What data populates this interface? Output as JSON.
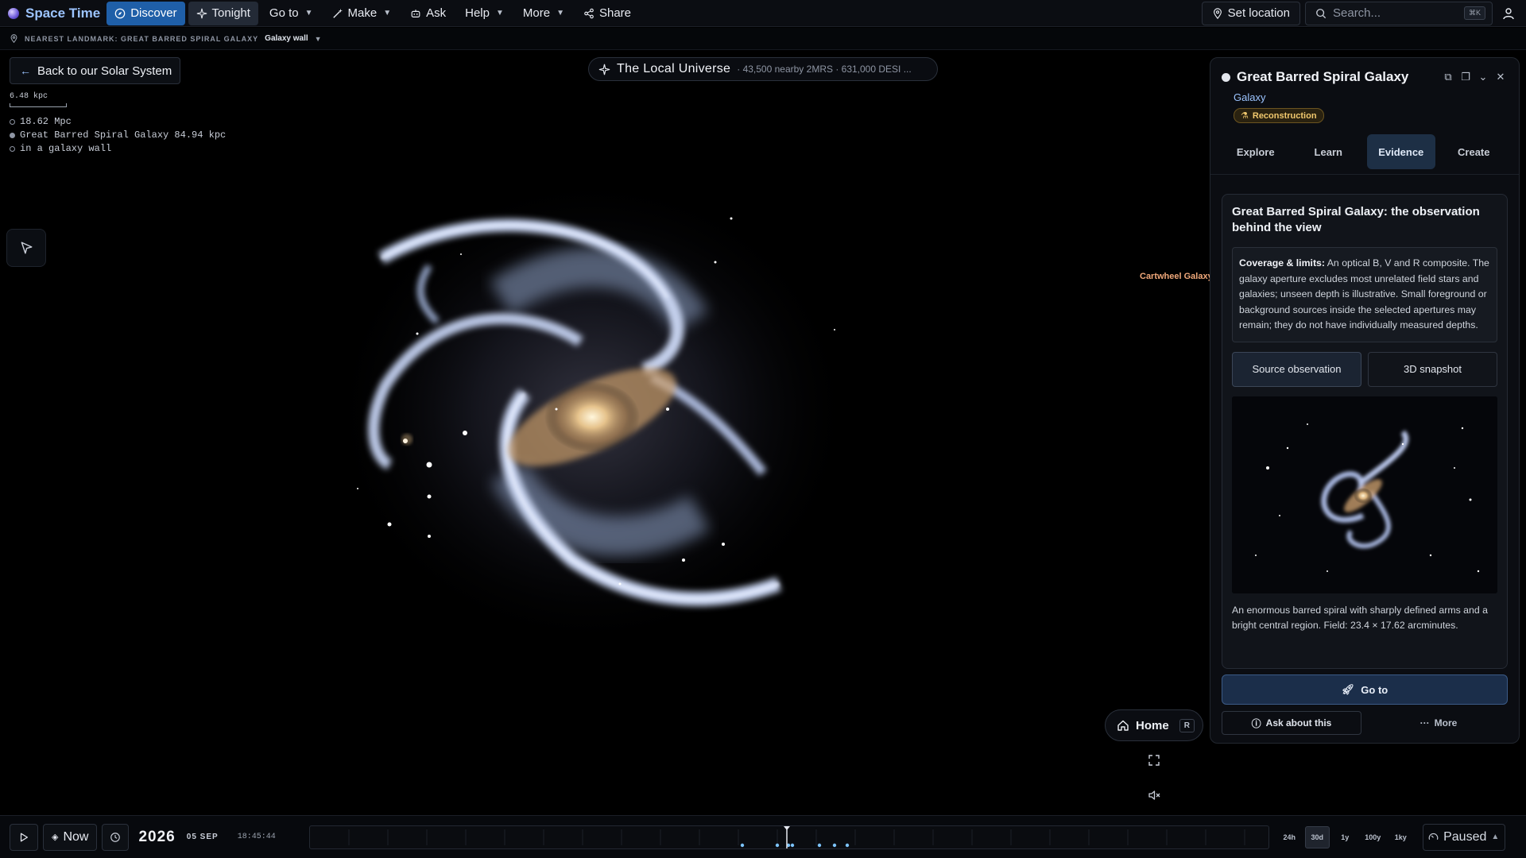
{
  "app": {
    "title": "Space Time",
    "nav": {
      "discover": "Discover",
      "tonight": "Tonight",
      "goto": "Go to",
      "make": "Make",
      "ask": "Ask",
      "help": "Help",
      "more": "More",
      "share": "Share"
    },
    "set_location": "Set location",
    "search_placeholder": "Search...",
    "search_shortcut": "⌘K"
  },
  "landmark": {
    "label": "NEAREST LANDMARK: GREAT BARRED SPIRAL GALAXY",
    "value": "Galaxy wall"
  },
  "viewer": {
    "back_label": "Back to our Solar System",
    "scale_label": "6.48 kpc",
    "context": [
      "18.62 Mpc",
      "Great Barred Spiral Galaxy 84.94 kpc",
      "in a galaxy wall"
    ],
    "universe_title": "The Local Universe",
    "universe_sub": "· 43,500 nearby 2MRS · 631,000 DESI ...",
    "neighbor_label": "Cartwheel Galaxy",
    "home_label": "Home",
    "home_key": "R"
  },
  "panel": {
    "title": "Great Barred Spiral Galaxy",
    "type": "Galaxy",
    "badge": "Reconstruction",
    "tabs": [
      "Explore",
      "Learn",
      "Evidence",
      "Create"
    ],
    "active_tab": "Evidence",
    "evidence_title": "Great Barred Spiral Galaxy: the observation behind the view",
    "coverage_label": "Coverage & limits:",
    "coverage_text": "An optical B, V and R composite. The galaxy aperture excludes most unrelated field stars and galaxies; unseen depth is illustrative. Small foreground or background sources inside the selected apertures may remain; they do not have individually measured depths.",
    "source_btn": "Source observation",
    "snapshot_btn": "3D snapshot",
    "caption": "An enormous barred spiral with sharply defined arms and a bright central region. Field: 23.4 × 17.62 arcminutes.",
    "goto_label": "Go to",
    "ask_label": "Ask about this",
    "more_label": "More"
  },
  "timeline": {
    "now_label": "Now",
    "year": "2026",
    "date": "05 SEP",
    "time": "18:45:44",
    "ranges": [
      "24h",
      "30d",
      "1y",
      "100y",
      "1ky"
    ],
    "active_range": "30d",
    "status": "Paused"
  }
}
